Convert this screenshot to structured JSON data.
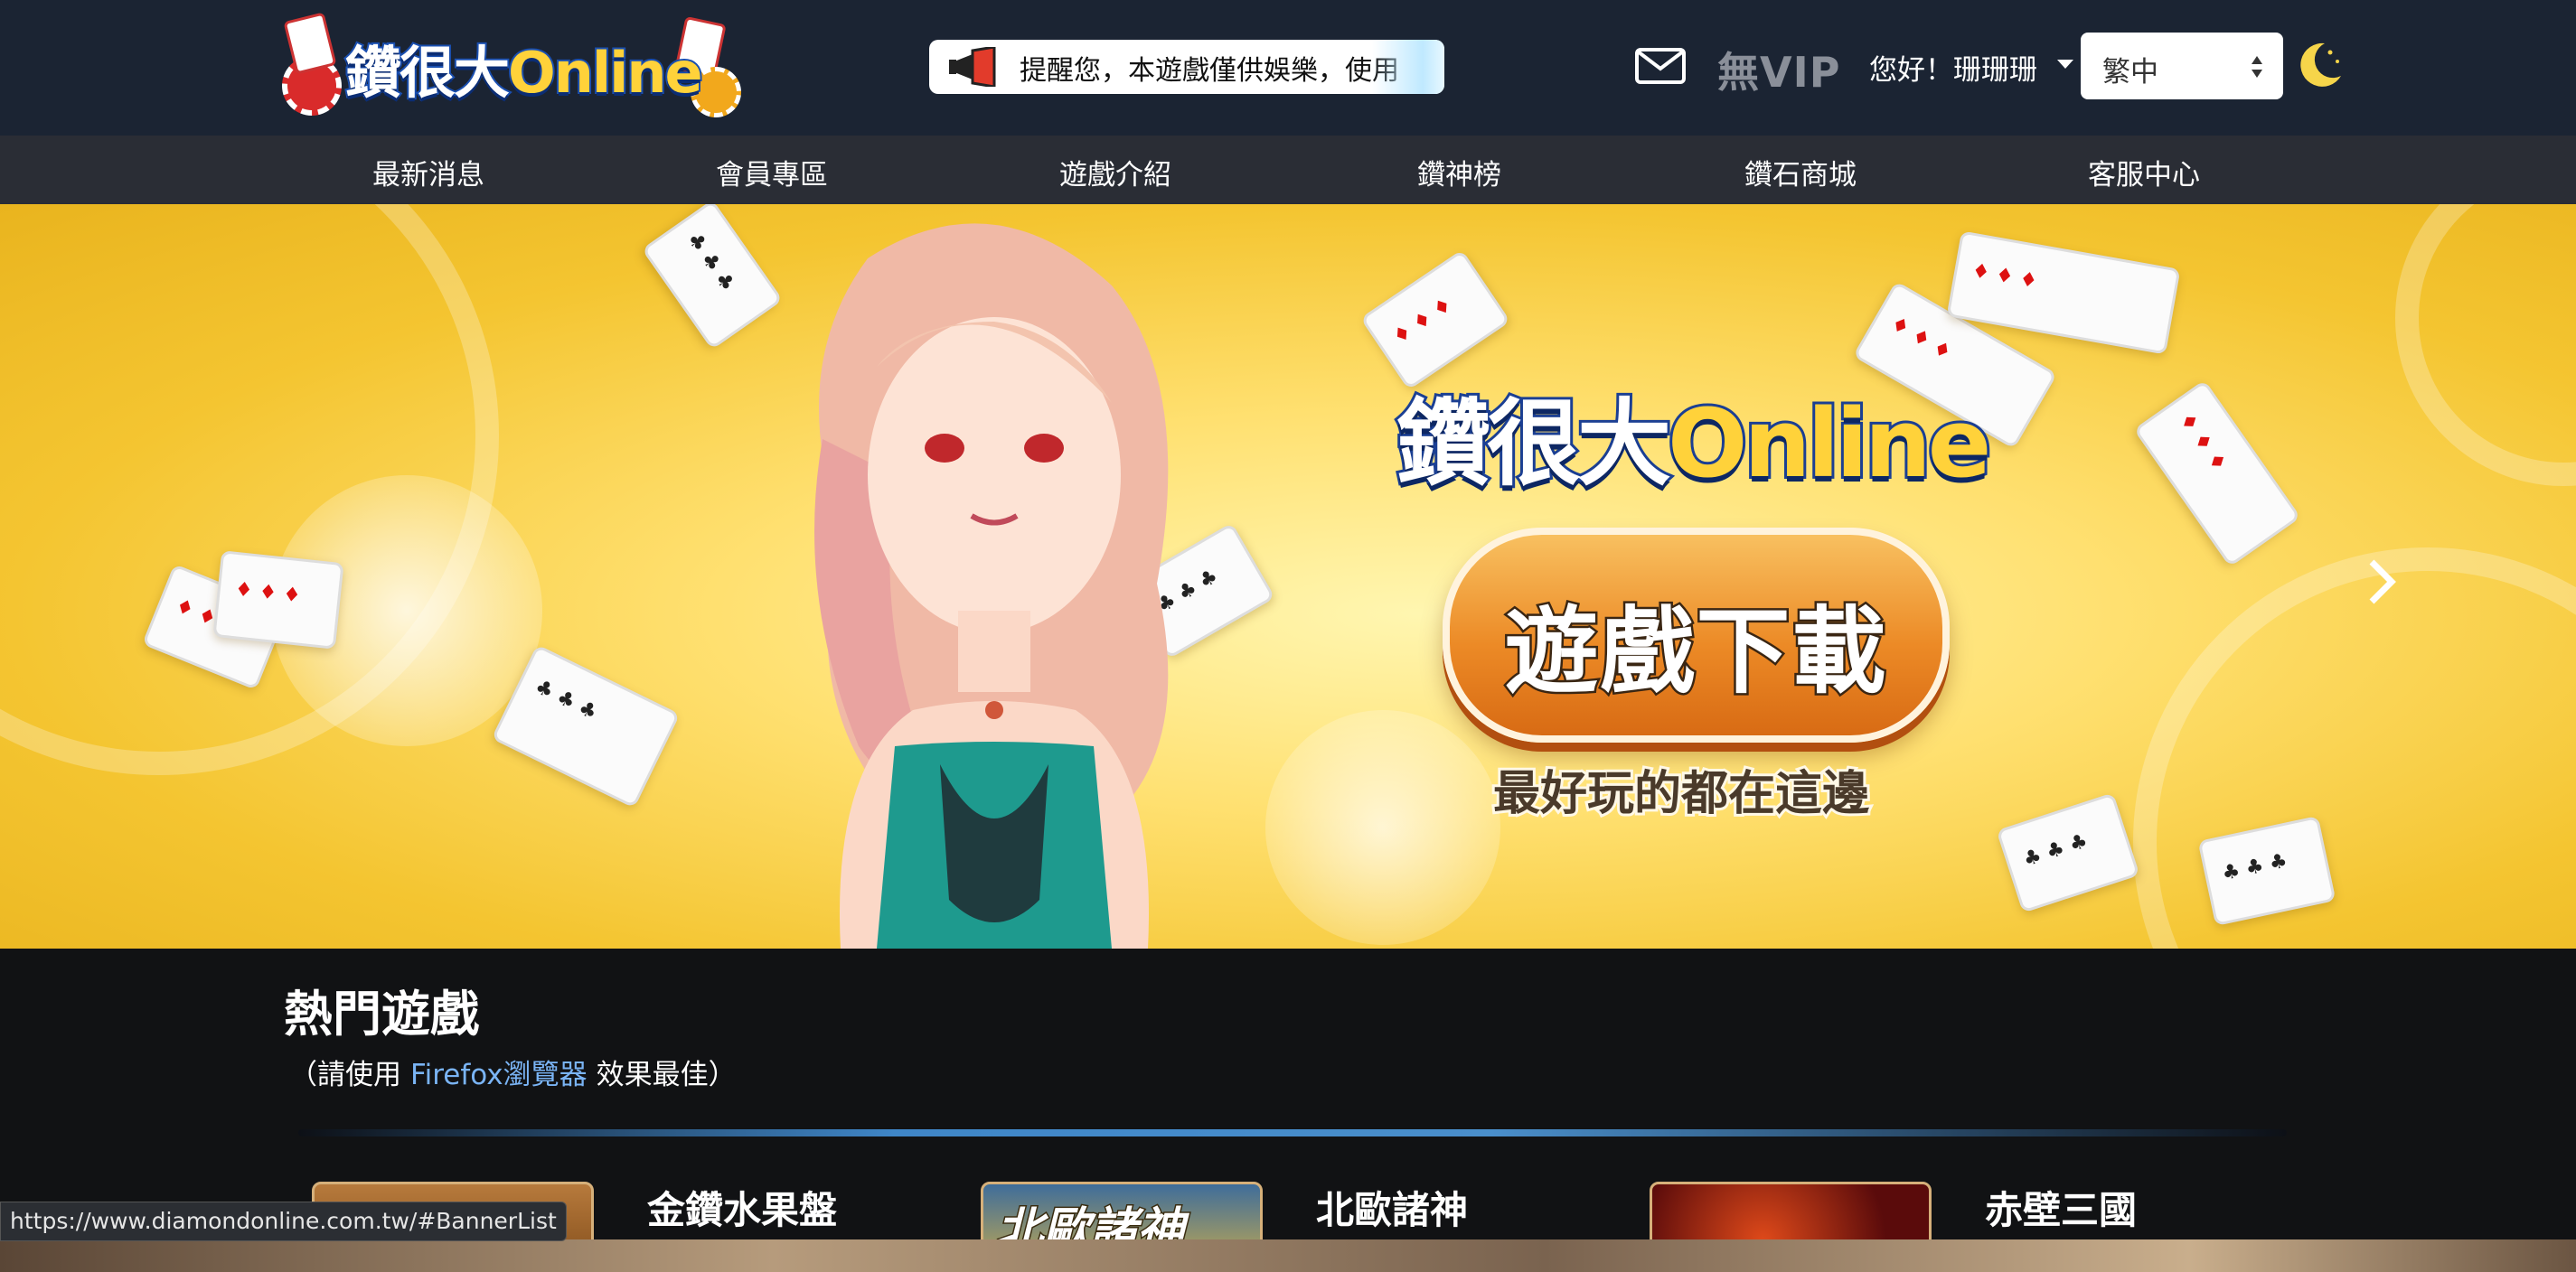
{
  "header": {
    "logo_text_zh": "鑽很大",
    "logo_text_en": "Online",
    "notice": "提醒您，本遊戲僅供娛樂，使用",
    "vip_label": "無VIP",
    "user_greeting": "您好！珊珊珊",
    "language": {
      "selected": "繁中"
    }
  },
  "nav": {
    "items": [
      "最新消息",
      "會員專區",
      "遊戲介紹",
      "鑽神榜",
      "鑽石商城",
      "客服中心"
    ]
  },
  "banner": {
    "logo_text_zh": "鑽很大",
    "logo_text_en": "Online",
    "download_label": "遊戲下載",
    "tagline": "最好玩的都在這邊"
  },
  "hot_games": {
    "title": "熱門遊戲",
    "sub_prefix": "（請使用",
    "sub_link": "Firefox瀏覽器",
    "sub_suffix": "效果最佳）",
    "games": [
      {
        "name": "金鑽水果盤"
      },
      {
        "name": "北歐諸神",
        "thumb_text": "北歐諸神"
      },
      {
        "name": "赤壁三國"
      }
    ]
  },
  "status_bar": {
    "url": "https://www.diamondonline.com.tw/#BannerList"
  },
  "colors": {
    "header_bg": "#1b2433",
    "nav_bg": "#2a2d35",
    "page_bg": "#111214",
    "link": "#7ab4f5",
    "banner_yellow": "#f4c531",
    "download_orange": "#ec8a26"
  },
  "icons": [
    "logo",
    "megaphone-icon",
    "mail-icon",
    "caret-down-icon",
    "select-arrows-icon",
    "moon-icon",
    "chevron-right-icon"
  ]
}
